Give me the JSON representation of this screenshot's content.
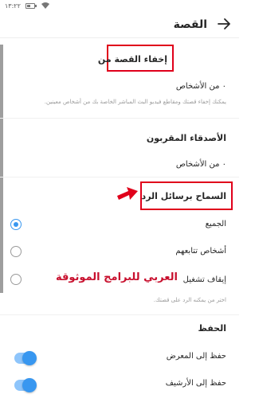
{
  "status_bar": {
    "time": "١٣:٢٢",
    "battery_level": 0.55,
    "signal_icon": "wifi-signal-icon"
  },
  "header": {
    "title": "القصة",
    "back_icon": "arrow-right-icon"
  },
  "hide_story": {
    "title": "إخفاء القصة من",
    "value": "٠ من الأشخاص",
    "caption": "يمكنك إخفاء قصتك ومقاطع فيديو البث المباشر الخاصة بك من أشخاص معينين."
  },
  "close_friends": {
    "title": "الأصدقاء المقربون",
    "value": "٠ من الأشخاص"
  },
  "allow_replies": {
    "title": "السماح برسائل الرد",
    "options": [
      {
        "label": "الجميع",
        "selected": true
      },
      {
        "label": "أشخاص تتابعهم",
        "selected": false
      },
      {
        "label": "إيقاف تشغيل",
        "selected": false
      }
    ],
    "caption": "اختر من يمكنه الرد على قصتك."
  },
  "watermark": "العربي للبرامج الموثوقة",
  "save": {
    "title": "الحفظ",
    "items": [
      {
        "label": "حفظ إلى المعرض",
        "on": true
      },
      {
        "label": "حفظ إلى الأرشيف",
        "on": true
      }
    ]
  },
  "colors": {
    "accent": "#3897f0",
    "highlight": "#e0001b",
    "watermark": "#c8102e"
  }
}
